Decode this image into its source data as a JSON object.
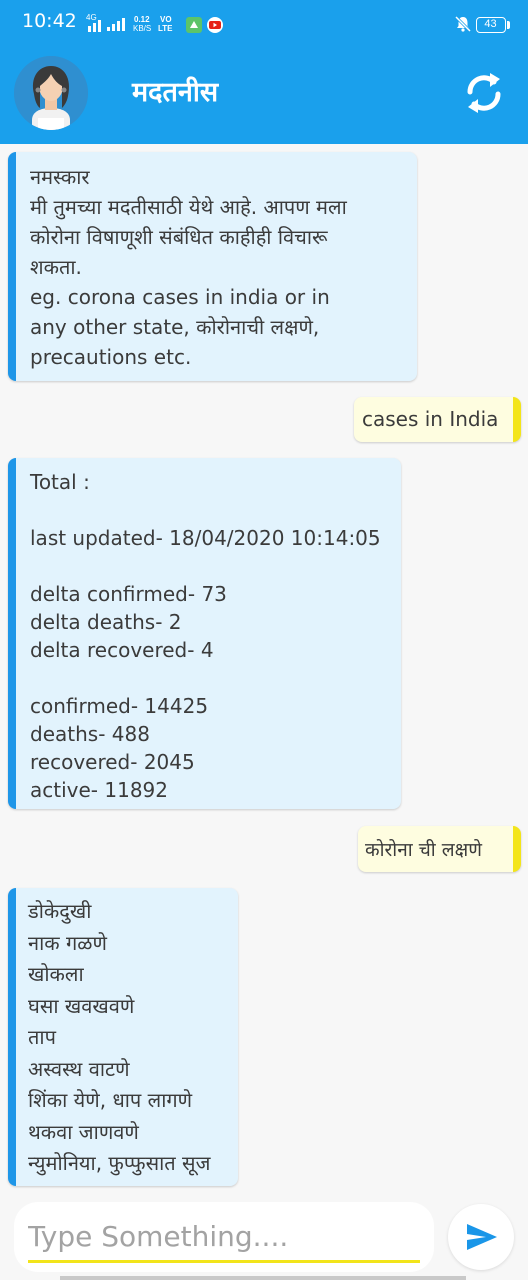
{
  "status_bar": {
    "time": "10:42",
    "network_tag": "4G",
    "speed_value": "0.12",
    "speed_unit": "KB/S",
    "vo_label": "VO",
    "lte_label": "LTE",
    "battery": "43",
    "bg_color": "#1aa0ec"
  },
  "app_bar": {
    "title": "मदतनीस",
    "bg_color": "#1aa0ec"
  },
  "messages": [
    {
      "sender": "bot",
      "lines": [
        "नमस्कार",
        "मी तुमच्या मदतीसाठी येथे आहे. आपण मला",
        "कोरोना विषाणूशी संबंधित काहीही विचारू",
        "शकता.",
        "eg. corona cases in india or in",
        "any other state, कोरोनाची लक्षणे,",
        "precautions etc."
      ]
    },
    {
      "sender": "user",
      "text": "cases in India"
    },
    {
      "sender": "bot",
      "lines": [
        "Total :",
        "",
        "last updated- 18/04/2020 10:14:05",
        "",
        "delta confirmed- 73",
        "delta deaths- 2",
        "delta recovered- 4",
        "",
        "confirmed- 14425",
        "deaths- 488",
        "recovered- 2045",
        "active- 11892"
      ]
    },
    {
      "sender": "user",
      "text": "कोरोना ची लक्षणे"
    },
    {
      "sender": "bot",
      "lines": [
        "डोकेदुखी",
        "नाक गळणे",
        "खोकला",
        "घसा खवखवणे",
        "ताप",
        "अस्वस्थ वाटणे",
        "शिंका येणे, धाप लागणे",
        "थकवा जाणवणे",
        "न्युमोनिया, फुप्फुसात सूज"
      ]
    }
  ],
  "input": {
    "placeholder": "Type Something....",
    "value": ""
  },
  "colors": {
    "bot_accent": "#1e96e8",
    "bot_bubble": "#e2f3fd",
    "user_accent": "#f3e51a",
    "user_bubble": "#fefde0",
    "send_icon": "#1a96e8"
  },
  "icons": {
    "refresh": "refresh-icon",
    "send": "send-icon",
    "avatar": "avatar"
  }
}
